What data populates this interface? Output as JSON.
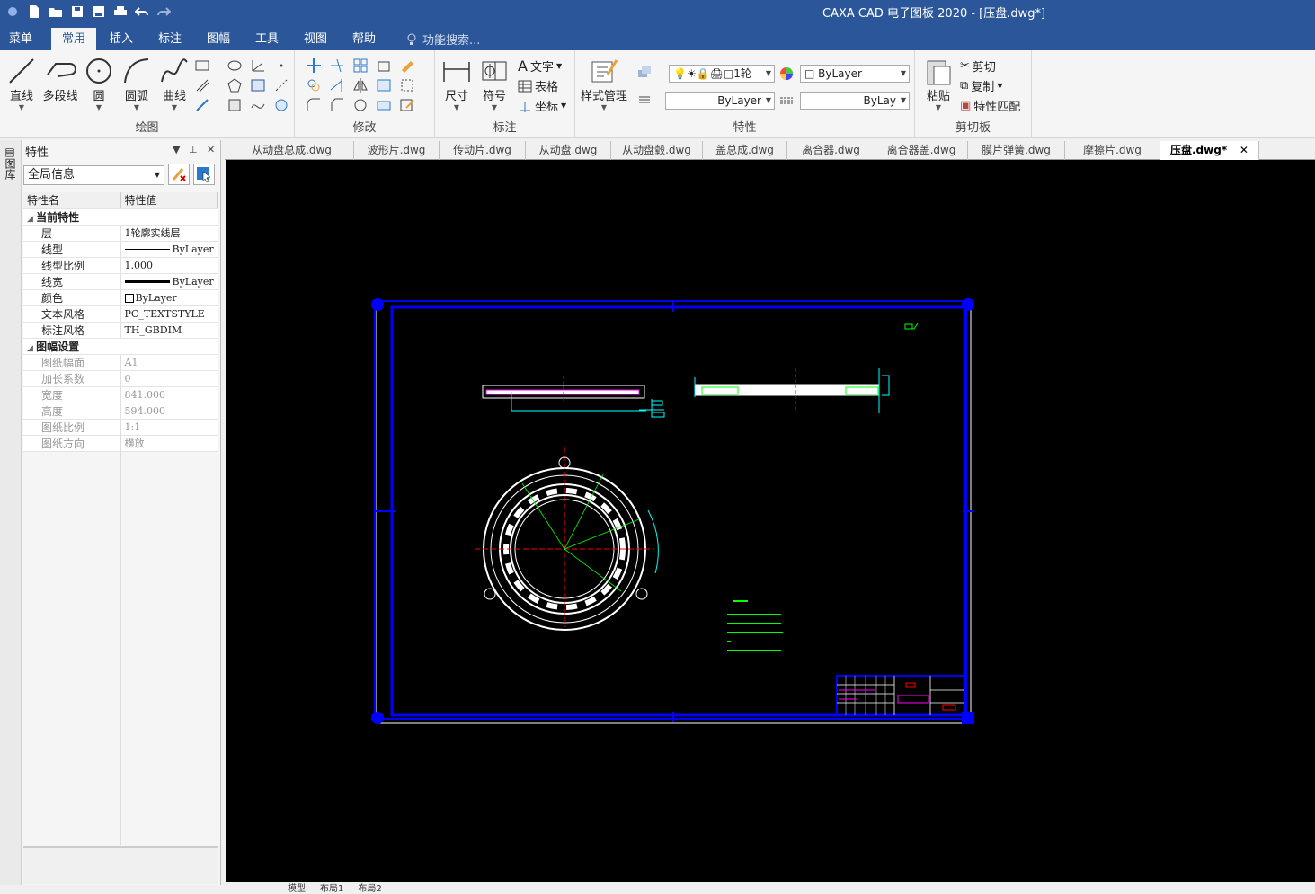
{
  "window": {
    "title": "CAXA CAD 电子图板 2020 - [压盘.dwg*]"
  },
  "menu": {
    "tabs": [
      "菜单",
      "常用",
      "插入",
      "标注",
      "图幅",
      "工具",
      "视图",
      "帮助"
    ],
    "active": "常用",
    "search": "功能搜索..."
  },
  "ribbon": {
    "draw": {
      "caption": "绘图",
      "line": "直线",
      "polyline": "多段线",
      "circle": "圆",
      "arc": "圆弧",
      "curve": "曲线"
    },
    "modify": {
      "caption": "修改"
    },
    "annotate": {
      "caption": "标注",
      "dim": "尺寸",
      "symbol": "符号",
      "text": "文字",
      "table": "表格",
      "coord": "坐标"
    },
    "props": {
      "caption": "特性",
      "style": "样式管理",
      "layer": "1轮",
      "bylayer1": "ByLayer",
      "bylayer2": "ByLayer",
      "bylayer3": "ByLay"
    },
    "clipboard": {
      "caption": "剪切板",
      "paste": "粘贴",
      "cut": "剪切",
      "copy": "复制",
      "match": "特性匹配"
    }
  },
  "panel": {
    "title": "特性",
    "side_tab": "图库",
    "scope": "全局信息",
    "col_name": "特性名",
    "col_value": "特性值",
    "sections": [
      {
        "title": "当前特性",
        "disabled": false,
        "rows": [
          [
            "层",
            "1轮廓实线层"
          ],
          [
            "线型",
            "ByLayer"
          ],
          [
            "线型比例",
            "1.000"
          ],
          [
            "线宽",
            "ByLayer"
          ],
          [
            "颜色",
            "ByLayer"
          ],
          [
            "文本风格",
            "PC_TEXTSTYLE"
          ],
          [
            "标注风格",
            "TH_GBDIM"
          ]
        ]
      },
      {
        "title": "图幅设置",
        "disabled": true,
        "rows": [
          [
            "图纸幅面",
            "A1"
          ],
          [
            "加长系数",
            "0"
          ],
          [
            "宽度",
            "841.000"
          ],
          [
            "高度",
            "594.000"
          ],
          [
            "图纸比例",
            "1:1"
          ],
          [
            "图纸方向",
            "横放"
          ]
        ]
      }
    ]
  },
  "file_tabs": [
    "从动盘总成.dwg",
    "波形片.dwg",
    "传动片.dwg",
    "从动盘.dwg",
    "从动盘毂.dwg",
    "盖总成.dwg",
    "离合器.dwg",
    "离合器盖.dwg",
    "膜片弹簧.dwg",
    "摩擦片.dwg",
    "压盘.dwg*"
  ],
  "active_file": "压盘.dwg*",
  "bottom_tabs": [
    "模型",
    "布局1",
    "布局2"
  ],
  "colors": {
    "accent": "#2b579a",
    "canvas": "#000000",
    "frame": "#0000ff",
    "geometry": "#ffffff",
    "annotation": "#00ff00",
    "center": "#ff0000",
    "dims": "#00ffff",
    "highlight": "#ff00ff"
  }
}
